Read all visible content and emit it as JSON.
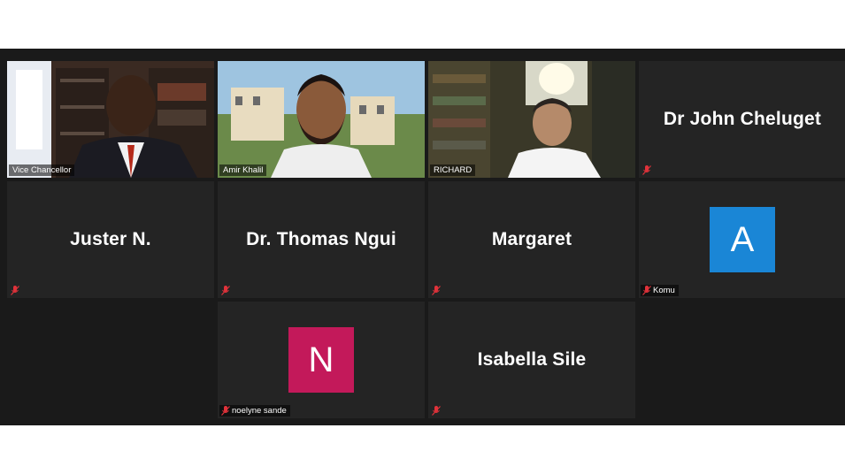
{
  "colors": {
    "gallery_background": "#1a1a1a",
    "tile_background": "#242424",
    "active_speaker_border": "#d8ea55",
    "mute_icon": "#e0323a",
    "avatar_a": "#1a86d6",
    "avatar_n": "#c3195a"
  },
  "participants": [
    {
      "label": "Vice Chancellor",
      "type": "video",
      "active": true
    },
    {
      "label": "Amir Khalil",
      "type": "video"
    },
    {
      "label": "RICHARD",
      "type": "video"
    },
    {
      "display_name": "Dr John Cheluget",
      "type": "name",
      "muted": true
    },
    {
      "display_name": "Juster N.",
      "type": "name",
      "muted": true
    },
    {
      "display_name": "Dr. Thomas Ngui",
      "type": "name",
      "muted": true
    },
    {
      "display_name": "Margaret",
      "type": "name",
      "muted": true
    },
    {
      "avatar_letter": "A",
      "label": "Komu",
      "type": "avatar",
      "muted": true
    },
    {
      "avatar_letter": "N",
      "label": "noelyne sande",
      "type": "avatar",
      "muted": true
    },
    {
      "display_name": "Isabella Sile",
      "type": "name",
      "muted": true
    }
  ]
}
